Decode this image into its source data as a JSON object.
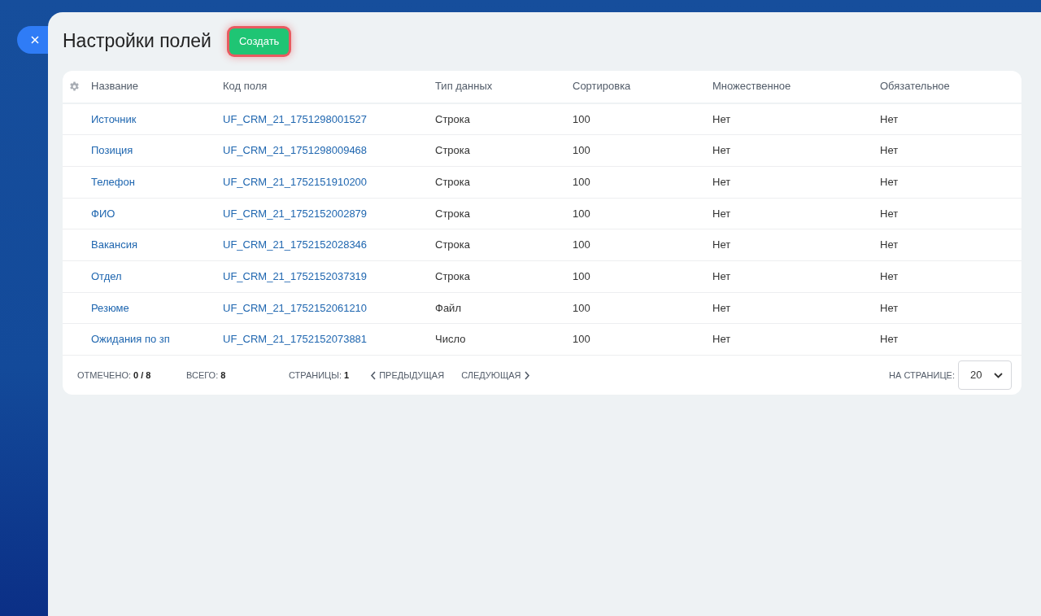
{
  "title": "Настройки полей",
  "create_button": "Создать",
  "table": {
    "columns": [
      "Название",
      "Код поля",
      "Тип данных",
      "Сортировка",
      "Множественное",
      "Обязательное"
    ],
    "rows": [
      [
        "Источник",
        "UF_CRM_21_1751298001527",
        "Строка",
        "100",
        "Нет",
        "Нет"
      ],
      [
        "Позиция",
        "UF_CRM_21_1751298009468",
        "Строка",
        "100",
        "Нет",
        "Нет"
      ],
      [
        "Телефон",
        "UF_CRM_21_1752151910200",
        "Строка",
        "100",
        "Нет",
        "Нет"
      ],
      [
        "ФИО",
        "UF_CRM_21_1752152002879",
        "Строка",
        "100",
        "Нет",
        "Нет"
      ],
      [
        "Вакансия",
        "UF_CRM_21_1752152028346",
        "Строка",
        "100",
        "Нет",
        "Нет"
      ],
      [
        "Отдел",
        "UF_CRM_21_1752152037319",
        "Строка",
        "100",
        "Нет",
        "Нет"
      ],
      [
        "Резюме",
        "UF_CRM_21_1752152061210",
        "Файл",
        "100",
        "Нет",
        "Нет"
      ],
      [
        "Ожидания по зп",
        "UF_CRM_21_1752152073881",
        "Число",
        "100",
        "Нет",
        "Нет"
      ]
    ]
  },
  "footer": {
    "checked_label": "ОТМЕЧЕНО:",
    "checked_value": "0 / 8",
    "total_label": "ВСЕГО:",
    "total_value": "8",
    "pages_label": "СТРАНИЦЫ:",
    "pages_value": "1",
    "prev": "ПРЕДЫДУЩАЯ",
    "next": "СЛЕДУЮЩАЯ",
    "per_page_label": "НА СТРАНИЦЕ:",
    "per_page_value": "20"
  }
}
